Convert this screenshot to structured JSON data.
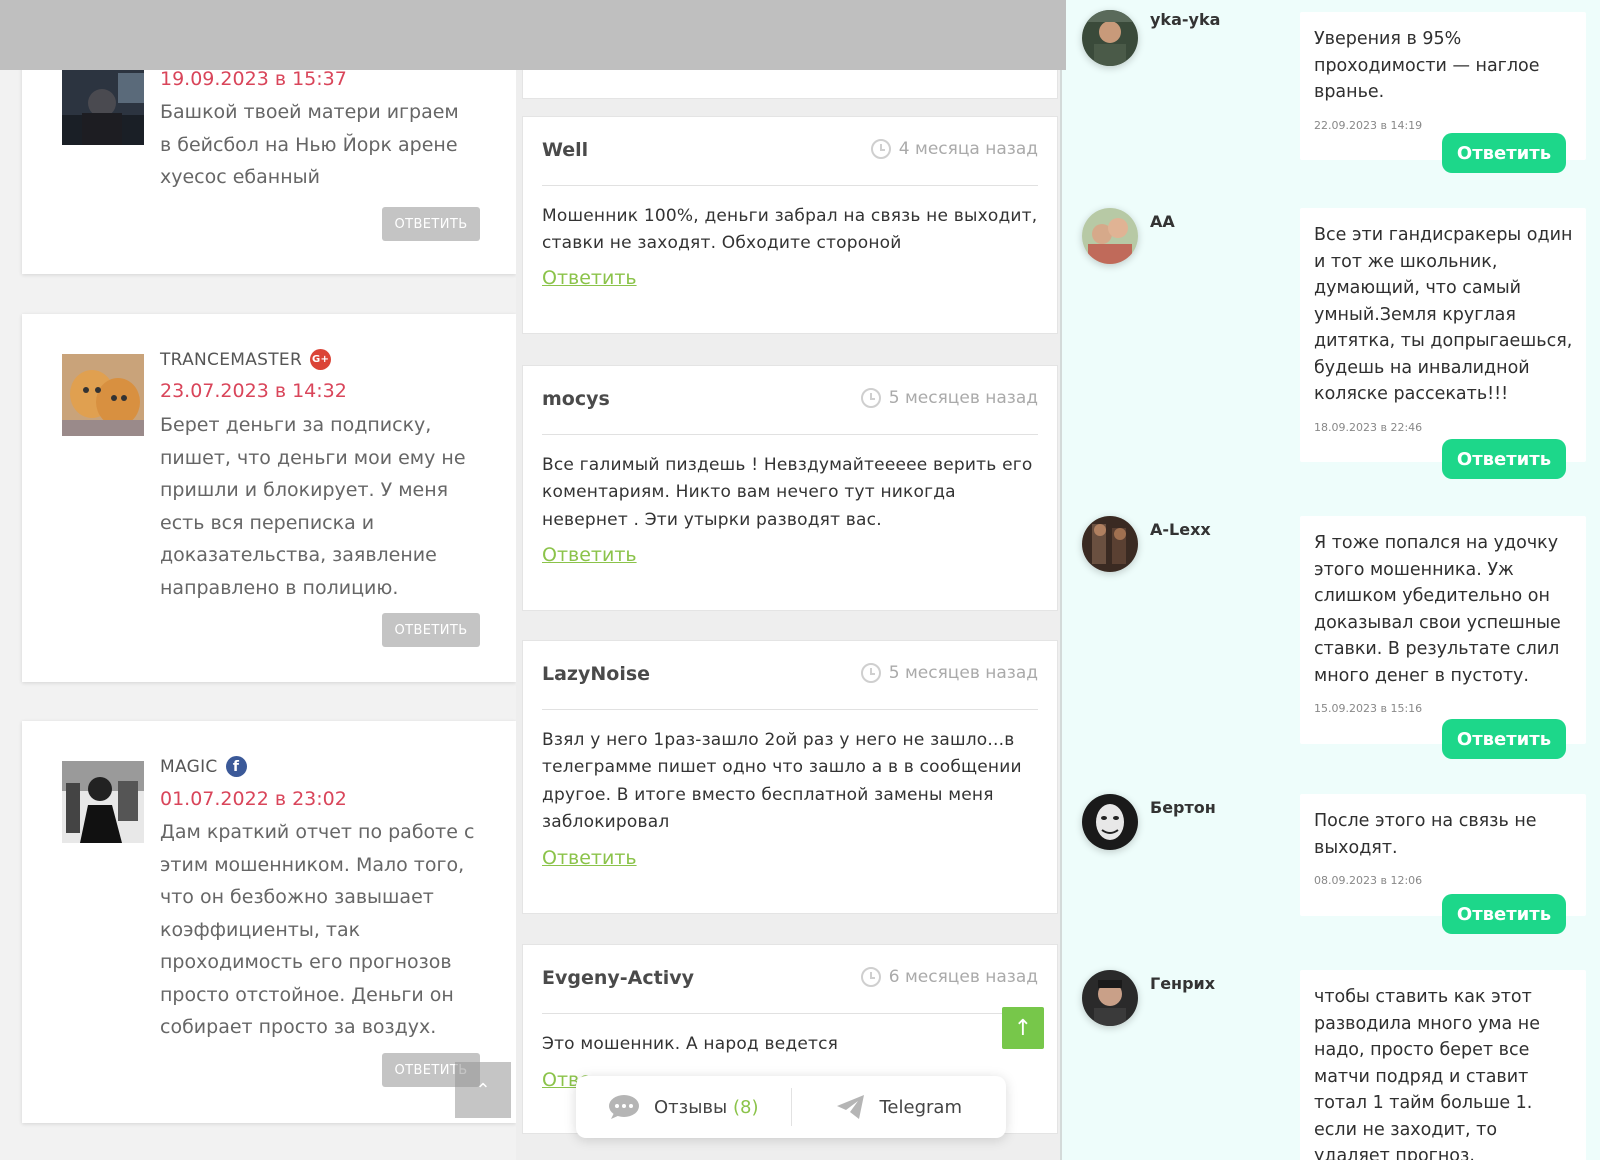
{
  "column1": {
    "reply_label": "ОТВЕТИТЬ",
    "comments": [
      {
        "author": "",
        "badge": "",
        "date": "19.09.2023 в 15:37",
        "text": "Башкой твоей матери играем в бейсбол на Нью Йорк арене хуесос ебанный"
      },
      {
        "author": "TRANCEMASTER",
        "badge": "G+",
        "date": "23.07.2023 в 14:32",
        "text": "Берет деньги за подписку, пишет, что деньги мои ему не пришли и блокирует. У меня есть вся переписка и доказательства, заявление направлено в полицию."
      },
      {
        "author": "MAGIC",
        "badge": "f",
        "date": "01.07.2022 в 23:02",
        "text": "Дам краткий отчет по работе с этим мошенником. Мало того, что он безбожно завышает коэффициенты, так проходимость его прогнозов просто отстойное. Деньги он собирает просто за воздух."
      }
    ]
  },
  "column2": {
    "reply_link": "Ответить",
    "reviews": [
      {
        "name": "Well",
        "ago": "4 месяца назад",
        "text": "Мошенник 100%, деньги забрал на связь не выходит, ставки не заходят. Обходите стороной"
      },
      {
        "name": "mocys",
        "ago": "5 месяцев назад",
        "text": "Все галимый пиздешь ! Невздумайтеееее верить его коментариям. Никто вам нечего тут никогда невернет . Эти утырки разводят вас."
      },
      {
        "name": "LazyNoise",
        "ago": "5 месяцев назад",
        "text": "Взял у него 1раз-зашло 2ой раз у него не зашло...в телеграмме пишет одно что зашло а в в сообщении другое. В итоге вместо бесплатной замены меня заблокировал"
      },
      {
        "name": "Evgeny-Activy",
        "ago": "6 месяцев назад",
        "text": "Это мошенник. А народ ведется",
        "link": "Отве"
      }
    ]
  },
  "column3": {
    "reply_label": "Ответить",
    "comments": [
      {
        "name": "yka-yka",
        "text": "Уверения в 95% проходимости — наглое вранье.",
        "date": "22.09.2023 в 14:19"
      },
      {
        "name": "AA",
        "text": "Все эти гандисракеры один и тот же школьник, думающий, что самый умный.Земля круглая дитятка, ты допрыгаешься, будешь на инвалидной коляске рассекать!!!",
        "date": "18.09.2023 в 22:46"
      },
      {
        "name": "A-Lexx",
        "text": "Я тоже попался на удочку этого мошенника. Уж слишком убедительно он доказывал свои успешные ставки. В результате слил много денег в пустоту.",
        "date": "15.09.2023 в 15:16"
      },
      {
        "name": "Бертон",
        "text": "После этого на связь не выходят.",
        "date": "08.09.2023 в 12:06"
      },
      {
        "name": "Генрих",
        "text": "чтобы ставить как этот разводила много ума не надо, просто берет все матчи подряд и ставит тотал 1 тайм больше 1. если не заходит, то удаляет прогноз."
      }
    ]
  },
  "bottombar": {
    "reviews_label": "Отзывы",
    "reviews_count": "(8)",
    "telegram_label": "Telegram"
  },
  "colors": {
    "date_red": "#d9455a",
    "link_green": "#8bc34a",
    "button_green": "#1dd78a",
    "scroll_green": "#77c74a"
  }
}
